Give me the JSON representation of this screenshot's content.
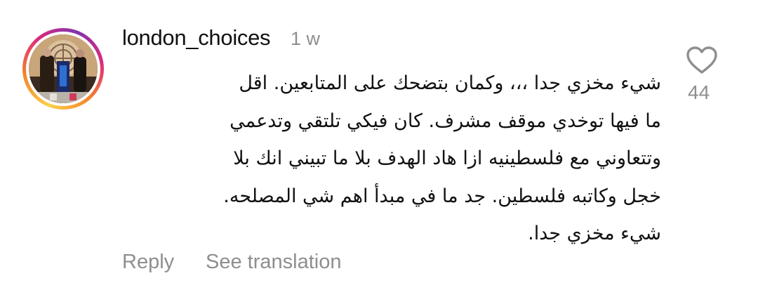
{
  "comment": {
    "username": "london_choices",
    "time": "1 w",
    "text_lines": [
      "شيء مخزي جدا ،،، وكمان بتضحك على المتابعين. اقل",
      "ما فيها توخدي موقف مشرف. كان فيكي تلتقي وتدعمي",
      "وتتعاوني مع فلسطينيه ازا هاد الهدف بلا ما تبيني انك بلا",
      "خجل وكاتبه فلسطين. جد ما في مبدأ اهم شي المصلحه.",
      "شيء مخزي جدا."
    ],
    "like_count": "44",
    "like_icon": "heart-outline-icon",
    "actions": {
      "reply": "Reply",
      "see_translation": "See translation"
    }
  },
  "colors": {
    "text": "#111111",
    "secondary": "#8e8e8e",
    "ring_gradient": [
      "#fbd14b",
      "#f58529",
      "#dd2a7b",
      "#8134af"
    ]
  }
}
